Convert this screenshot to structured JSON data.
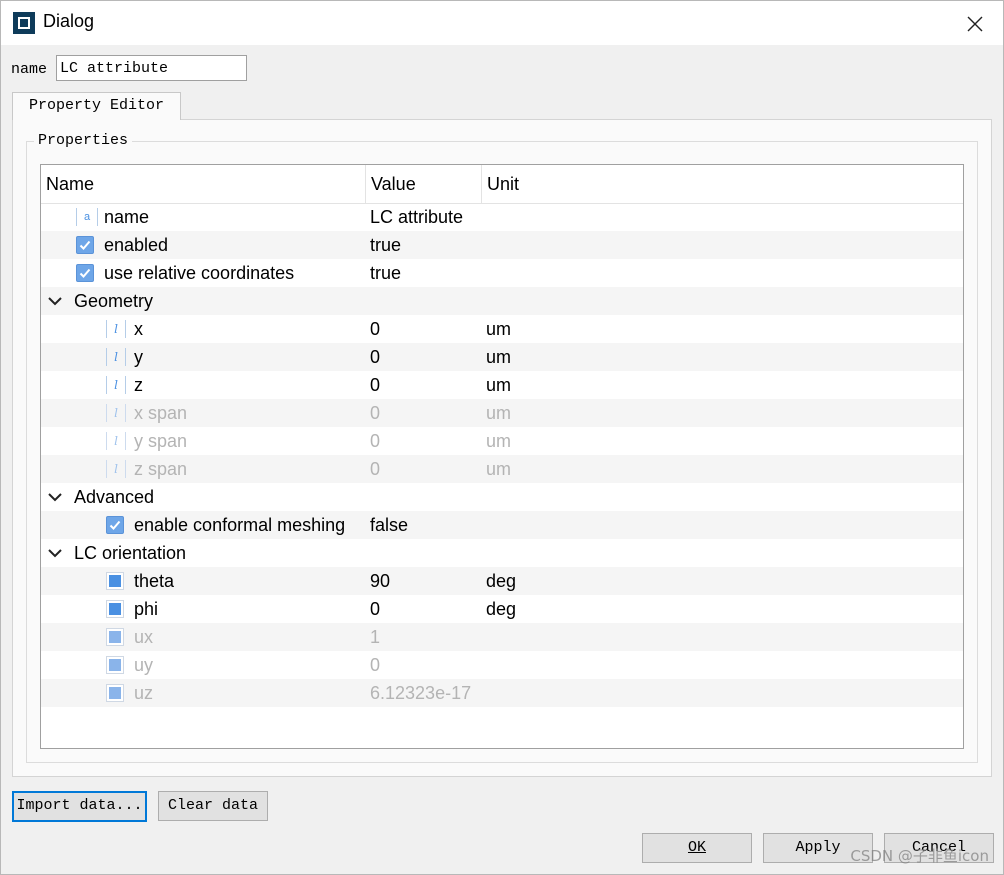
{
  "window": {
    "title": "Dialog"
  },
  "name_field": {
    "label": "name",
    "value": "LC attribute"
  },
  "tabs": [
    {
      "label": "Property Editor"
    }
  ],
  "properties": {
    "group_title": "Properties",
    "columns": [
      "Name",
      "Value",
      "Unit"
    ],
    "rows": [
      {
        "name": "name",
        "value": "LC attribute",
        "unit": "",
        "icon": "string-icon",
        "level": 1
      },
      {
        "name": "enabled",
        "value": "true",
        "unit": "",
        "icon": "checkbox-icon",
        "level": 1
      },
      {
        "name": "use relative coordinates",
        "value": "true",
        "unit": "",
        "icon": "checkbox-icon",
        "level": 1
      },
      {
        "name": "Geometry",
        "group": true,
        "level": 0
      },
      {
        "name": "x",
        "value": "0",
        "unit": "um",
        "icon": "text-icon",
        "level": 2
      },
      {
        "name": "y",
        "value": "0",
        "unit": "um",
        "icon": "text-icon",
        "level": 2
      },
      {
        "name": "z",
        "value": "0",
        "unit": "um",
        "icon": "text-icon",
        "level": 2
      },
      {
        "name": "x span",
        "value": "0",
        "unit": "um",
        "icon": "text-icon",
        "level": 2,
        "disabled": true
      },
      {
        "name": "y span",
        "value": "0",
        "unit": "um",
        "icon": "text-icon",
        "level": 2,
        "disabled": true
      },
      {
        "name": "z span",
        "value": "0",
        "unit": "um",
        "icon": "text-icon",
        "level": 2,
        "disabled": true
      },
      {
        "name": "Advanced",
        "group": true,
        "level": 0
      },
      {
        "name": "enable conformal meshing",
        "value": "false",
        "unit": "",
        "icon": "checkbox-icon",
        "level": 2
      },
      {
        "name": "LC orientation",
        "group": true,
        "level": 0
      },
      {
        "name": "theta",
        "value": "90",
        "unit": "deg",
        "icon": "number-icon",
        "level": 2
      },
      {
        "name": "phi",
        "value": "0",
        "unit": "deg",
        "icon": "number-icon",
        "level": 2
      },
      {
        "name": "ux",
        "value": "1",
        "unit": "",
        "icon": "number-icon",
        "level": 2,
        "disabled": true
      },
      {
        "name": "uy",
        "value": "0",
        "unit": "",
        "icon": "number-icon",
        "level": 2,
        "disabled": true
      },
      {
        "name": "uz",
        "value": "6.12323e-17",
        "unit": "",
        "icon": "number-icon",
        "level": 2,
        "disabled": true
      }
    ]
  },
  "buttons": {
    "import": "Import data...",
    "clear": "Clear data",
    "ok": "OK",
    "apply": "Apply",
    "cancel": "Cancel"
  },
  "watermark": "CSDN @子非鱼icon",
  "colors": {
    "accent": "#0078d7",
    "icon_blue": "#4a90e2",
    "disabled_text": "#b4b4b4"
  }
}
